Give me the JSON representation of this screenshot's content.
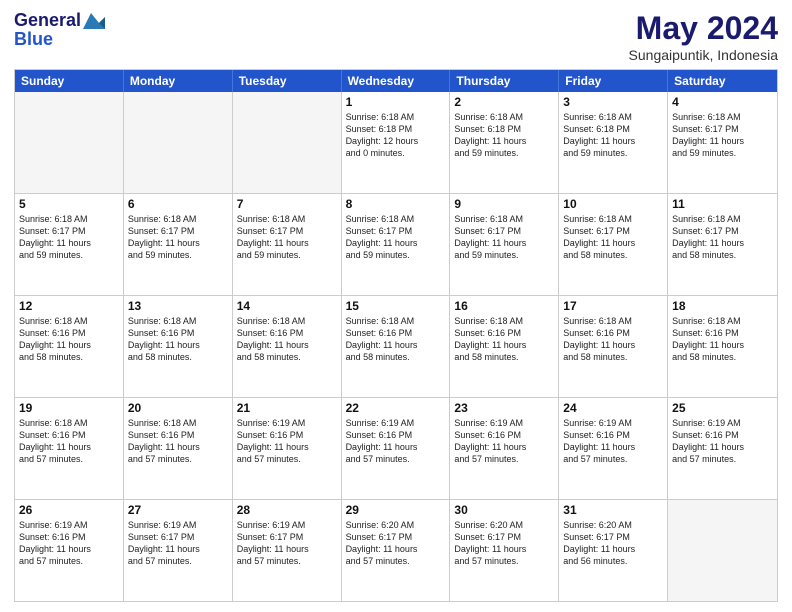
{
  "header": {
    "logo_general": "General",
    "logo_blue": "Blue",
    "month_title": "May 2024",
    "location": "Sungaipuntik, Indonesia"
  },
  "day_headers": [
    "Sunday",
    "Monday",
    "Tuesday",
    "Wednesday",
    "Thursday",
    "Friday",
    "Saturday"
  ],
  "weeks": [
    [
      {
        "day": "",
        "info": "",
        "empty": true
      },
      {
        "day": "",
        "info": "",
        "empty": true
      },
      {
        "day": "",
        "info": "",
        "empty": true
      },
      {
        "day": "1",
        "info": "Sunrise: 6:18 AM\nSunset: 6:18 PM\nDaylight: 12 hours\nand 0 minutes.",
        "empty": false
      },
      {
        "day": "2",
        "info": "Sunrise: 6:18 AM\nSunset: 6:18 PM\nDaylight: 11 hours\nand 59 minutes.",
        "empty": false
      },
      {
        "day": "3",
        "info": "Sunrise: 6:18 AM\nSunset: 6:18 PM\nDaylight: 11 hours\nand 59 minutes.",
        "empty": false
      },
      {
        "day": "4",
        "info": "Sunrise: 6:18 AM\nSunset: 6:17 PM\nDaylight: 11 hours\nand 59 minutes.",
        "empty": false
      }
    ],
    [
      {
        "day": "5",
        "info": "Sunrise: 6:18 AM\nSunset: 6:17 PM\nDaylight: 11 hours\nand 59 minutes.",
        "empty": false
      },
      {
        "day": "6",
        "info": "Sunrise: 6:18 AM\nSunset: 6:17 PM\nDaylight: 11 hours\nand 59 minutes.",
        "empty": false
      },
      {
        "day": "7",
        "info": "Sunrise: 6:18 AM\nSunset: 6:17 PM\nDaylight: 11 hours\nand 59 minutes.",
        "empty": false
      },
      {
        "day": "8",
        "info": "Sunrise: 6:18 AM\nSunset: 6:17 PM\nDaylight: 11 hours\nand 59 minutes.",
        "empty": false
      },
      {
        "day": "9",
        "info": "Sunrise: 6:18 AM\nSunset: 6:17 PM\nDaylight: 11 hours\nand 59 minutes.",
        "empty": false
      },
      {
        "day": "10",
        "info": "Sunrise: 6:18 AM\nSunset: 6:17 PM\nDaylight: 11 hours\nand 58 minutes.",
        "empty": false
      },
      {
        "day": "11",
        "info": "Sunrise: 6:18 AM\nSunset: 6:17 PM\nDaylight: 11 hours\nand 58 minutes.",
        "empty": false
      }
    ],
    [
      {
        "day": "12",
        "info": "Sunrise: 6:18 AM\nSunset: 6:16 PM\nDaylight: 11 hours\nand 58 minutes.",
        "empty": false
      },
      {
        "day": "13",
        "info": "Sunrise: 6:18 AM\nSunset: 6:16 PM\nDaylight: 11 hours\nand 58 minutes.",
        "empty": false
      },
      {
        "day": "14",
        "info": "Sunrise: 6:18 AM\nSunset: 6:16 PM\nDaylight: 11 hours\nand 58 minutes.",
        "empty": false
      },
      {
        "day": "15",
        "info": "Sunrise: 6:18 AM\nSunset: 6:16 PM\nDaylight: 11 hours\nand 58 minutes.",
        "empty": false
      },
      {
        "day": "16",
        "info": "Sunrise: 6:18 AM\nSunset: 6:16 PM\nDaylight: 11 hours\nand 58 minutes.",
        "empty": false
      },
      {
        "day": "17",
        "info": "Sunrise: 6:18 AM\nSunset: 6:16 PM\nDaylight: 11 hours\nand 58 minutes.",
        "empty": false
      },
      {
        "day": "18",
        "info": "Sunrise: 6:18 AM\nSunset: 6:16 PM\nDaylight: 11 hours\nand 58 minutes.",
        "empty": false
      }
    ],
    [
      {
        "day": "19",
        "info": "Sunrise: 6:18 AM\nSunset: 6:16 PM\nDaylight: 11 hours\nand 57 minutes.",
        "empty": false
      },
      {
        "day": "20",
        "info": "Sunrise: 6:18 AM\nSunset: 6:16 PM\nDaylight: 11 hours\nand 57 minutes.",
        "empty": false
      },
      {
        "day": "21",
        "info": "Sunrise: 6:19 AM\nSunset: 6:16 PM\nDaylight: 11 hours\nand 57 minutes.",
        "empty": false
      },
      {
        "day": "22",
        "info": "Sunrise: 6:19 AM\nSunset: 6:16 PM\nDaylight: 11 hours\nand 57 minutes.",
        "empty": false
      },
      {
        "day": "23",
        "info": "Sunrise: 6:19 AM\nSunset: 6:16 PM\nDaylight: 11 hours\nand 57 minutes.",
        "empty": false
      },
      {
        "day": "24",
        "info": "Sunrise: 6:19 AM\nSunset: 6:16 PM\nDaylight: 11 hours\nand 57 minutes.",
        "empty": false
      },
      {
        "day": "25",
        "info": "Sunrise: 6:19 AM\nSunset: 6:16 PM\nDaylight: 11 hours\nand 57 minutes.",
        "empty": false
      }
    ],
    [
      {
        "day": "26",
        "info": "Sunrise: 6:19 AM\nSunset: 6:16 PM\nDaylight: 11 hours\nand 57 minutes.",
        "empty": false
      },
      {
        "day": "27",
        "info": "Sunrise: 6:19 AM\nSunset: 6:17 PM\nDaylight: 11 hours\nand 57 minutes.",
        "empty": false
      },
      {
        "day": "28",
        "info": "Sunrise: 6:19 AM\nSunset: 6:17 PM\nDaylight: 11 hours\nand 57 minutes.",
        "empty": false
      },
      {
        "day": "29",
        "info": "Sunrise: 6:20 AM\nSunset: 6:17 PM\nDaylight: 11 hours\nand 57 minutes.",
        "empty": false
      },
      {
        "day": "30",
        "info": "Sunrise: 6:20 AM\nSunset: 6:17 PM\nDaylight: 11 hours\nand 57 minutes.",
        "empty": false
      },
      {
        "day": "31",
        "info": "Sunrise: 6:20 AM\nSunset: 6:17 PM\nDaylight: 11 hours\nand 56 minutes.",
        "empty": false
      },
      {
        "day": "",
        "info": "",
        "empty": true
      }
    ]
  ]
}
